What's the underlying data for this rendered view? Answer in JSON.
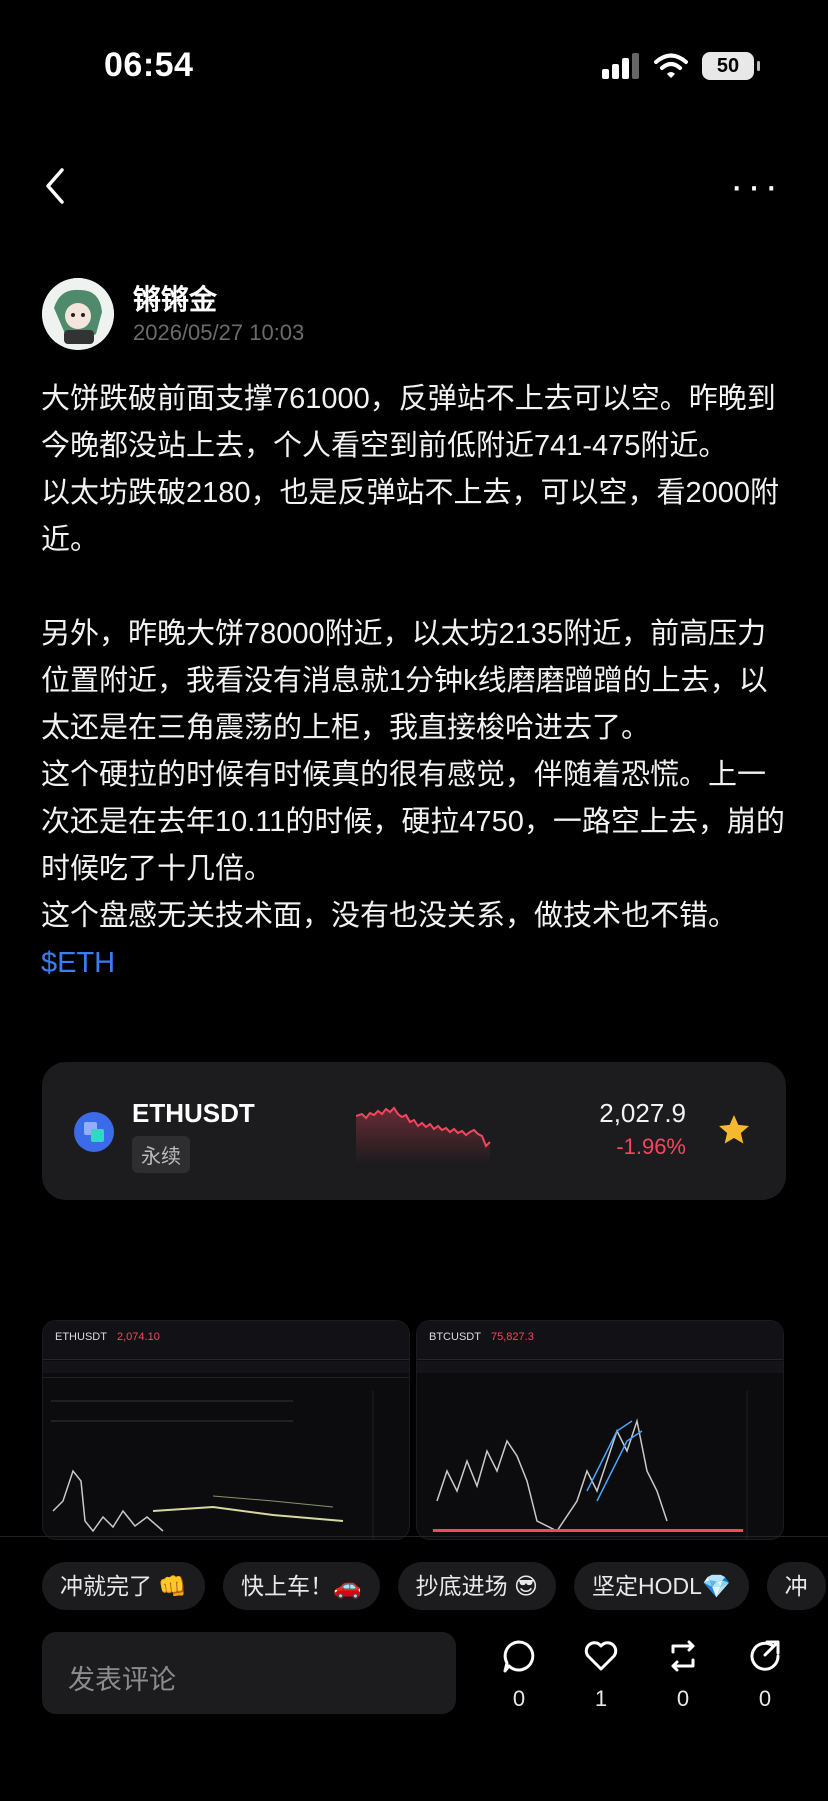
{
  "status_bar": {
    "time": "06:54",
    "battery": "50"
  },
  "author": {
    "name": "锵锵金",
    "time": "2026/05/27 10:03"
  },
  "post": {
    "paragraphs": [
      "大饼跌破前面支撑761000，反弹站不上去可以空。昨晚到今晚都没站上去，个人看空到前低附近741-475附近。",
      "以太坊跌破2180，也是反弹站不上去，可以空，看2000附近。",
      "另外，昨晚大饼78000附近，以太坊2135附近，前高压力位置附近，我看没有消息就1分钟k线磨磨蹭蹭的上去，以太还是在三角震荡的上柜，我直接梭哈进去了。",
      "这个硬拉的时候有时候真的很有感觉，伴随着恐慌。上一次还是在去年10.11的时候，硬拉4750，一路空上去，崩的时候吃了十几倍。",
      "这个盘感无关技术面，没有也没关系，做技术也不错。"
    ],
    "tag": "$ETH"
  },
  "ticker": {
    "symbol": "ETHUSDT",
    "type": "永续",
    "price": "2,027.9",
    "change": "-1.96%",
    "change_color": "#f6465d",
    "favorited": true
  },
  "screenshots": [
    {
      "symbol": "ETHUSDT",
      "price": "2,074.10",
      "price_color": "#f6465d"
    },
    {
      "symbol": "BTCUSDT",
      "price": "75,827.3",
      "price_color": "#f6465d"
    }
  ],
  "quick_replies": [
    "冲就完了 👊",
    "快上车！🚗",
    "抄底进场 😎",
    "坚定HODL💎",
    "冲"
  ],
  "comment": {
    "placeholder": "发表评论"
  },
  "actions": {
    "comments": "0",
    "likes": "1",
    "reposts": "0",
    "shares": "0"
  }
}
